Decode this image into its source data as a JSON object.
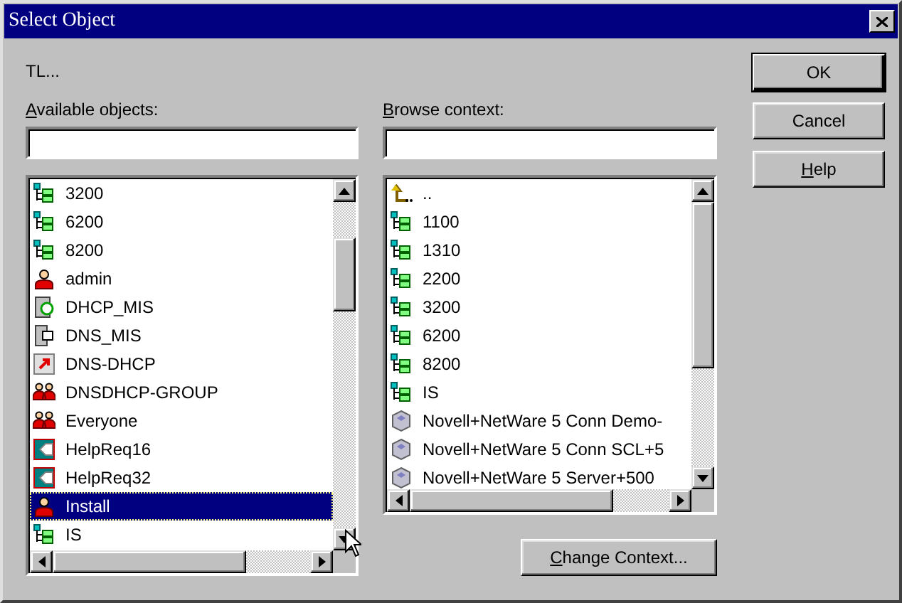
{
  "window": {
    "title": "Select Object"
  },
  "current_context": "TL...",
  "available_objects": {
    "label": {
      "accel": "A",
      "rest": "vailable objects:"
    },
    "items": [
      {
        "name": "3200",
        "kind": "container",
        "selected": false
      },
      {
        "name": "6200",
        "kind": "container",
        "selected": false
      },
      {
        "name": "8200",
        "kind": "container",
        "selected": false
      },
      {
        "name": "admin",
        "kind": "user",
        "selected": false
      },
      {
        "name": "DHCP_MIS",
        "kind": "dhcp",
        "selected": false
      },
      {
        "name": "DNS_MIS",
        "kind": "dns",
        "selected": false
      },
      {
        "name": "DNS-DHCP",
        "kind": "application",
        "selected": false
      },
      {
        "name": "DNSDHCP-GROUP",
        "kind": "group",
        "selected": false
      },
      {
        "name": "Everyone",
        "kind": "group",
        "selected": false
      },
      {
        "name": "HelpReq16",
        "kind": "template",
        "selected": false
      },
      {
        "name": "HelpReq32",
        "kind": "template",
        "selected": false
      },
      {
        "name": "Install",
        "kind": "user",
        "selected": true
      },
      {
        "name": "IS",
        "kind": "container",
        "selected": false
      }
    ]
  },
  "browse_context": {
    "label": {
      "accel": "B",
      "rest": "rowse context:"
    },
    "items": [
      {
        "name": "..",
        "kind": "parent",
        "selected": false
      },
      {
        "name": "1100",
        "kind": "container",
        "selected": false
      },
      {
        "name": "1310",
        "kind": "container",
        "selected": false
      },
      {
        "name": "2200",
        "kind": "container",
        "selected": false
      },
      {
        "name": "3200",
        "kind": "container",
        "selected": false
      },
      {
        "name": "6200",
        "kind": "container",
        "selected": false
      },
      {
        "name": "8200",
        "kind": "container",
        "selected": false
      },
      {
        "name": "IS",
        "kind": "container",
        "selected": false
      },
      {
        "name": "Novell+NetWare 5 Conn Demo-",
        "kind": "server",
        "selected": false
      },
      {
        "name": "Novell+NetWare 5 Conn SCL+5",
        "kind": "server",
        "selected": false
      },
      {
        "name": "Novell+NetWare 5 Server+500",
        "kind": "server",
        "selected": false
      }
    ]
  },
  "change_context_button": {
    "accel": "C",
    "rest": "hange Context..."
  },
  "buttons": [
    {
      "label": "OK",
      "default": true
    },
    {
      "label": "Cancel",
      "default": false
    },
    {
      "accel": "H",
      "rest": "elp",
      "default": false
    }
  ]
}
